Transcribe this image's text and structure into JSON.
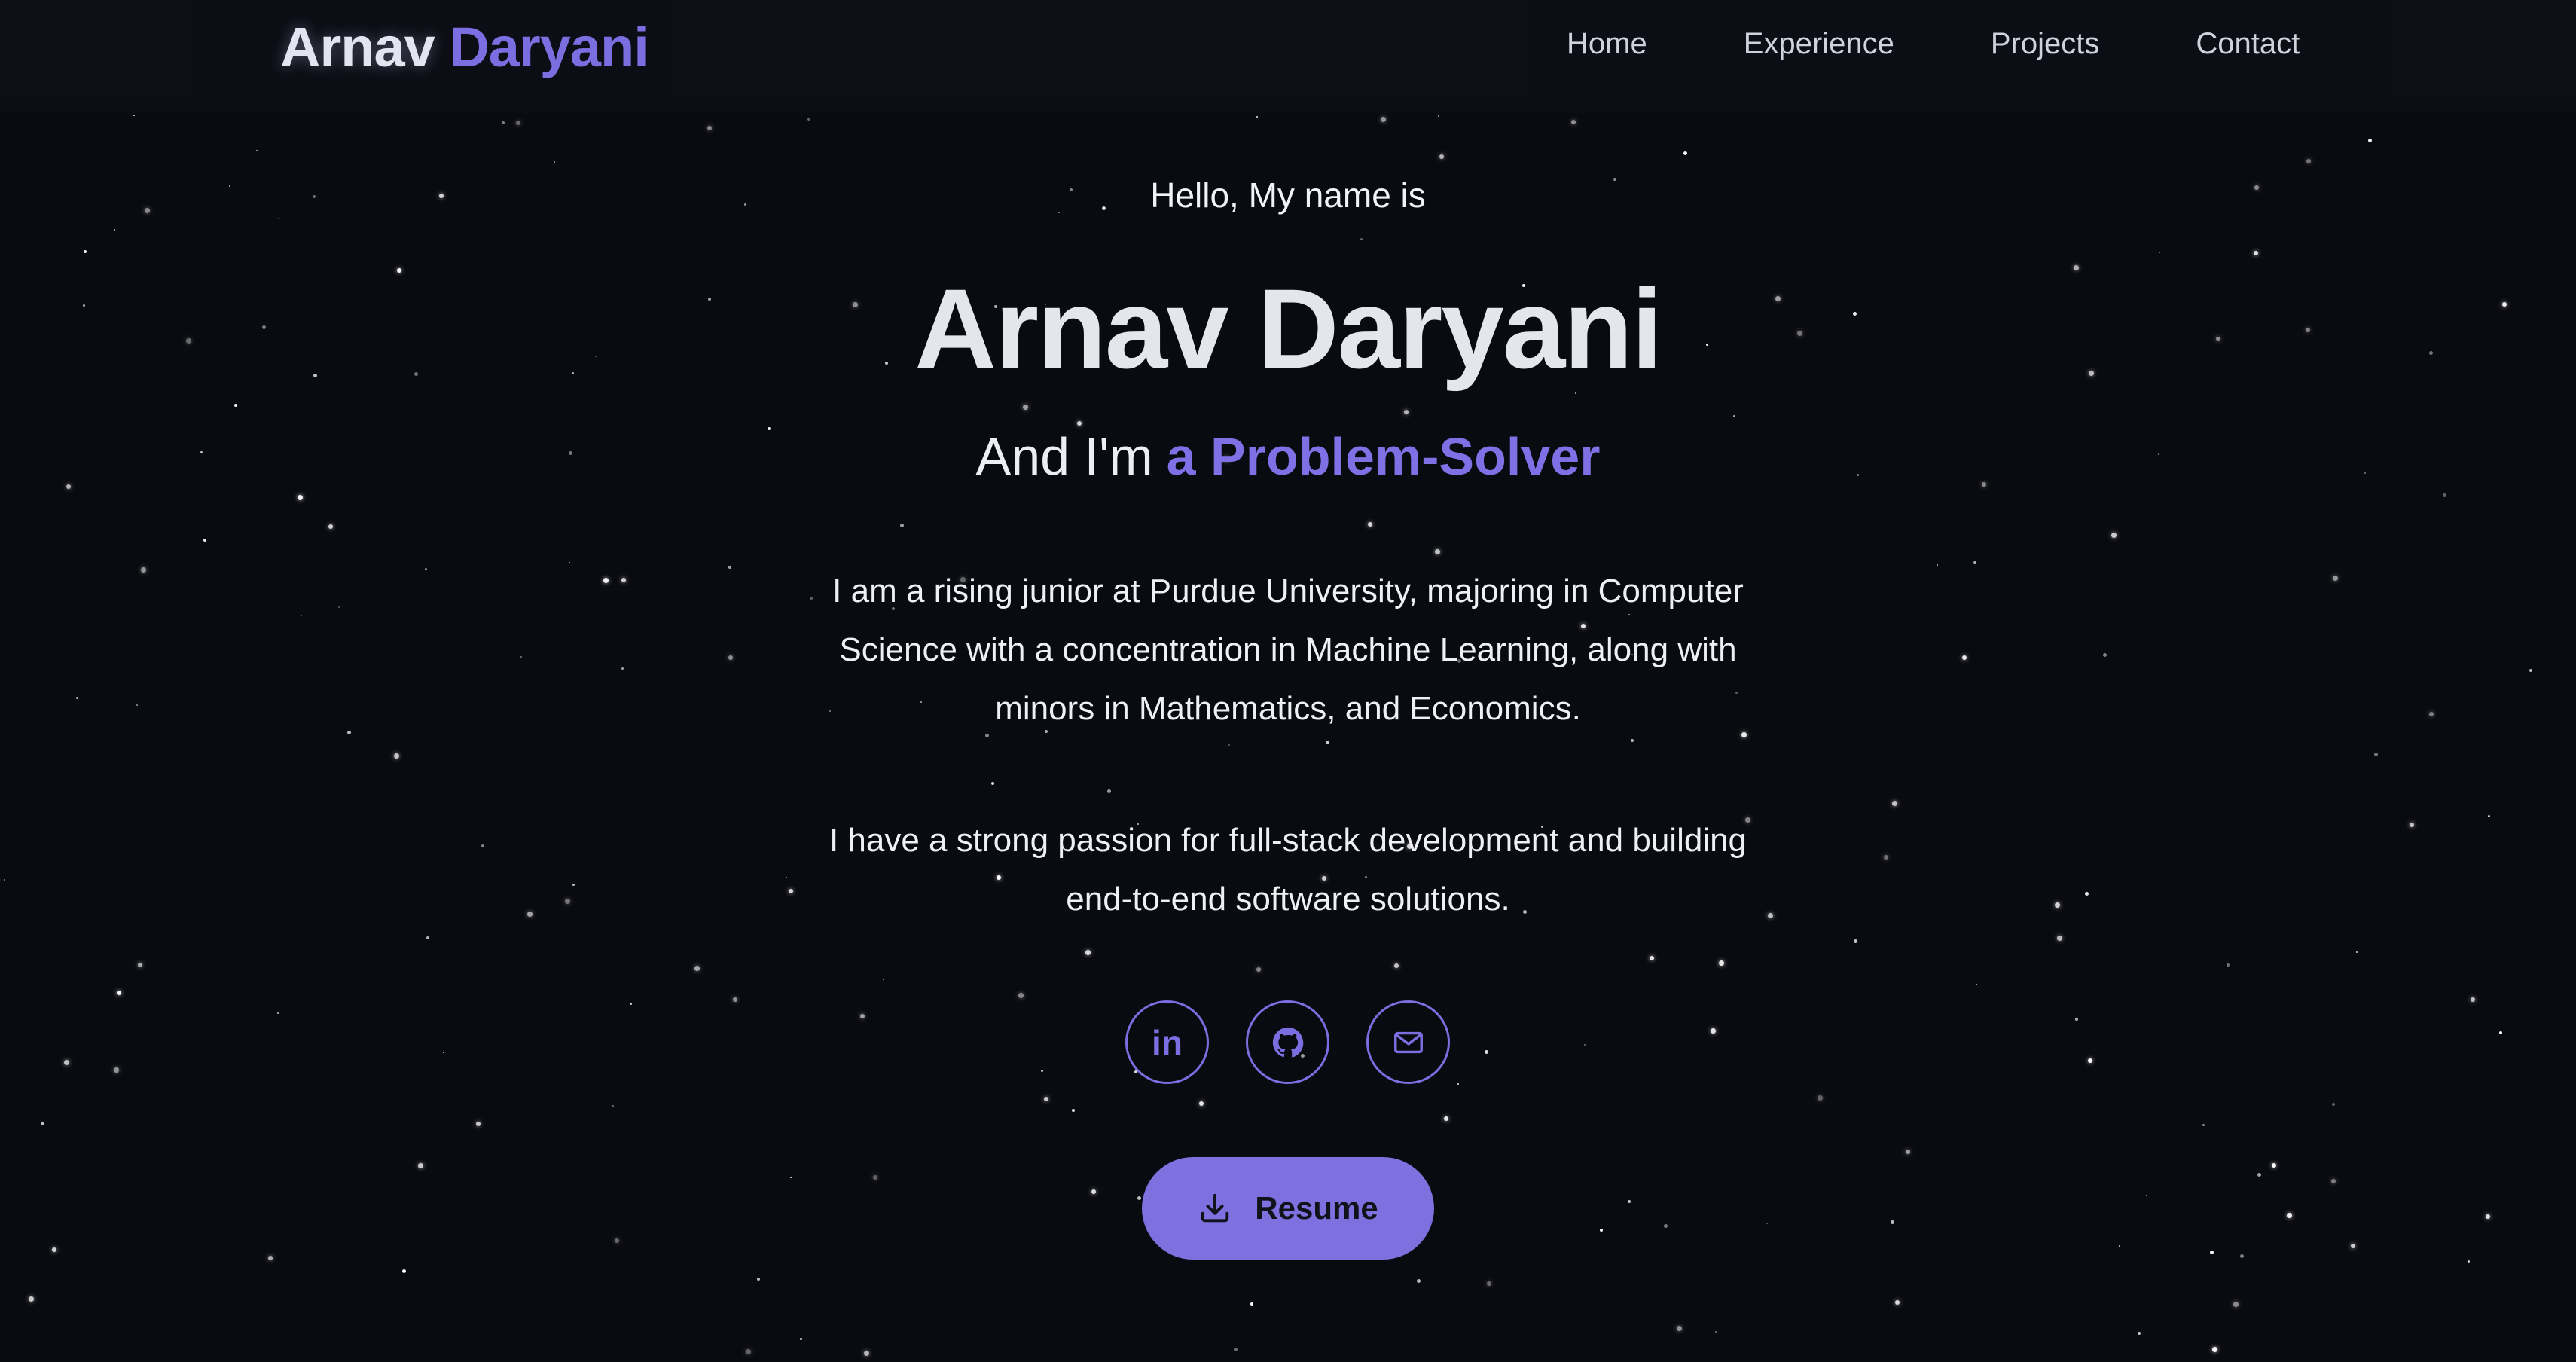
{
  "brand": {
    "first": "Arnav",
    "last": "Daryani"
  },
  "nav": {
    "items": [
      {
        "label": "Home"
      },
      {
        "label": "Experience"
      },
      {
        "label": "Projects"
      },
      {
        "label": "Contact"
      }
    ]
  },
  "hero": {
    "greeting": "Hello, My name is",
    "name": "Arnav Daryani",
    "tagline_prefix": "And I'm",
    "tagline_role": "a Problem-Solver",
    "bio_paragraph_1": [
      "I am a rising junior at Purdue University, majoring in Computer",
      "Science with a concentration in Machine Learning, along with",
      "minors in Mathematics, and Economics."
    ],
    "bio_paragraph_2": [
      "I have a strong passion for full-stack development and building",
      "end-to-end software solutions."
    ]
  },
  "socials": [
    {
      "icon": "linkedin-icon",
      "label": "in"
    },
    {
      "icon": "github-icon"
    },
    {
      "icon": "mail-icon"
    }
  ],
  "resume_button": {
    "label": "Resume",
    "icon": "download-icon"
  },
  "colors": {
    "background": "#0a0b10",
    "accent": "#7b6ee0",
    "button": "#7f70df",
    "text": "#e6e8ee"
  }
}
